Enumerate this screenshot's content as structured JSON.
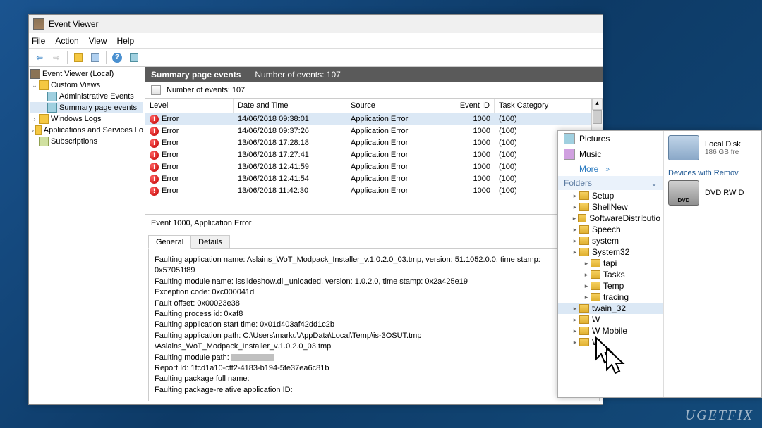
{
  "window": {
    "title": "Event Viewer"
  },
  "menu": {
    "file": "File",
    "action": "Action",
    "view": "View",
    "help": "Help"
  },
  "tree": {
    "root": "Event Viewer (Local)",
    "custom_views": "Custom Views",
    "administrative_events": "Administrative Events",
    "summary_page_events": "Summary page events",
    "windows_logs": "Windows Logs",
    "applications_services": "Applications and Services Lo",
    "subscriptions": "Subscriptions"
  },
  "panel": {
    "title": "Summary page events",
    "count_label": "Number of events: 107",
    "filter_count": "Number of events: 107"
  },
  "columns": {
    "level": "Level",
    "date": "Date and Time",
    "source": "Source",
    "eventid": "Event ID",
    "task": "Task Category"
  },
  "events": [
    {
      "level": "Error",
      "date": "14/06/2018 09:38:01",
      "source": "Application Error",
      "id": "1000",
      "task": "(100)"
    },
    {
      "level": "Error",
      "date": "14/06/2018 09:37:26",
      "source": "Application Error",
      "id": "1000",
      "task": "(100)"
    },
    {
      "level": "Error",
      "date": "13/06/2018 17:28:18",
      "source": "Application Error",
      "id": "1000",
      "task": "(100)"
    },
    {
      "level": "Error",
      "date": "13/06/2018 17:27:41",
      "source": "Application Error",
      "id": "1000",
      "task": "(100)"
    },
    {
      "level": "Error",
      "date": "13/06/2018 12:41:59",
      "source": "Application Error",
      "id": "1000",
      "task": "(100)"
    },
    {
      "level": "Error",
      "date": "13/06/2018 12:41:54",
      "source": "Application Error",
      "id": "1000",
      "task": "(100)"
    },
    {
      "level": "Error",
      "date": "13/06/2018 11:42:30",
      "source": "Application Error",
      "id": "1000",
      "task": "(100)"
    }
  ],
  "detail": {
    "header": "Event 1000, Application Error",
    "tabs": {
      "general": "General",
      "details": "Details"
    },
    "l1": "Faulting application name: Aslains_WoT_Modpack_Installer_v.1.0.2.0_03.tmp, version: 51.1052.0.0, time stamp:",
    "l2": "0x57051f89",
    "l3": "Faulting module name: isslideshow.dll_unloaded, version: 1.0.2.0, time stamp: 0x2a425e19",
    "l4": "Exception code: 0xc000041d",
    "l5": "Fault offset: 0x00023e38",
    "l6": "Faulting process id: 0xaf8",
    "l7": "Faulting application start time: 0x01d403af42dd1c2b",
    "l8": "Faulting application path: C:\\Users\\marku\\AppData\\Local\\Temp\\is-3OSUT.tmp",
    "l9": "\\Aslains_WoT_Modpack_Installer_v.1.0.2.0_03.tmp",
    "l10": "Faulting module path:",
    "l11": "Report Id: 1fcd1a10-cff2-4183-b194-5fe37ea6c81b",
    "l12": "Faulting package full name:",
    "l13": "Faulting package-relative application ID:"
  },
  "explorer": {
    "pictures": "Pictures",
    "music": "Music",
    "more": "More",
    "folders_header": "Folders",
    "folders": [
      "Setup",
      "ShellNew",
      "SoftwareDistributio",
      "Speech",
      "system",
      "System32",
      "tapi",
      "Tasks",
      "Temp",
      "tracing",
      "twain_32",
      "W",
      "W          Mobile",
      "W"
    ],
    "local_disk": "Local Disk",
    "local_disk_free": "186 GB fre",
    "devices_header": "Devices with Remov",
    "dvd": "DVD RW D"
  },
  "watermark": "UGETFIX"
}
